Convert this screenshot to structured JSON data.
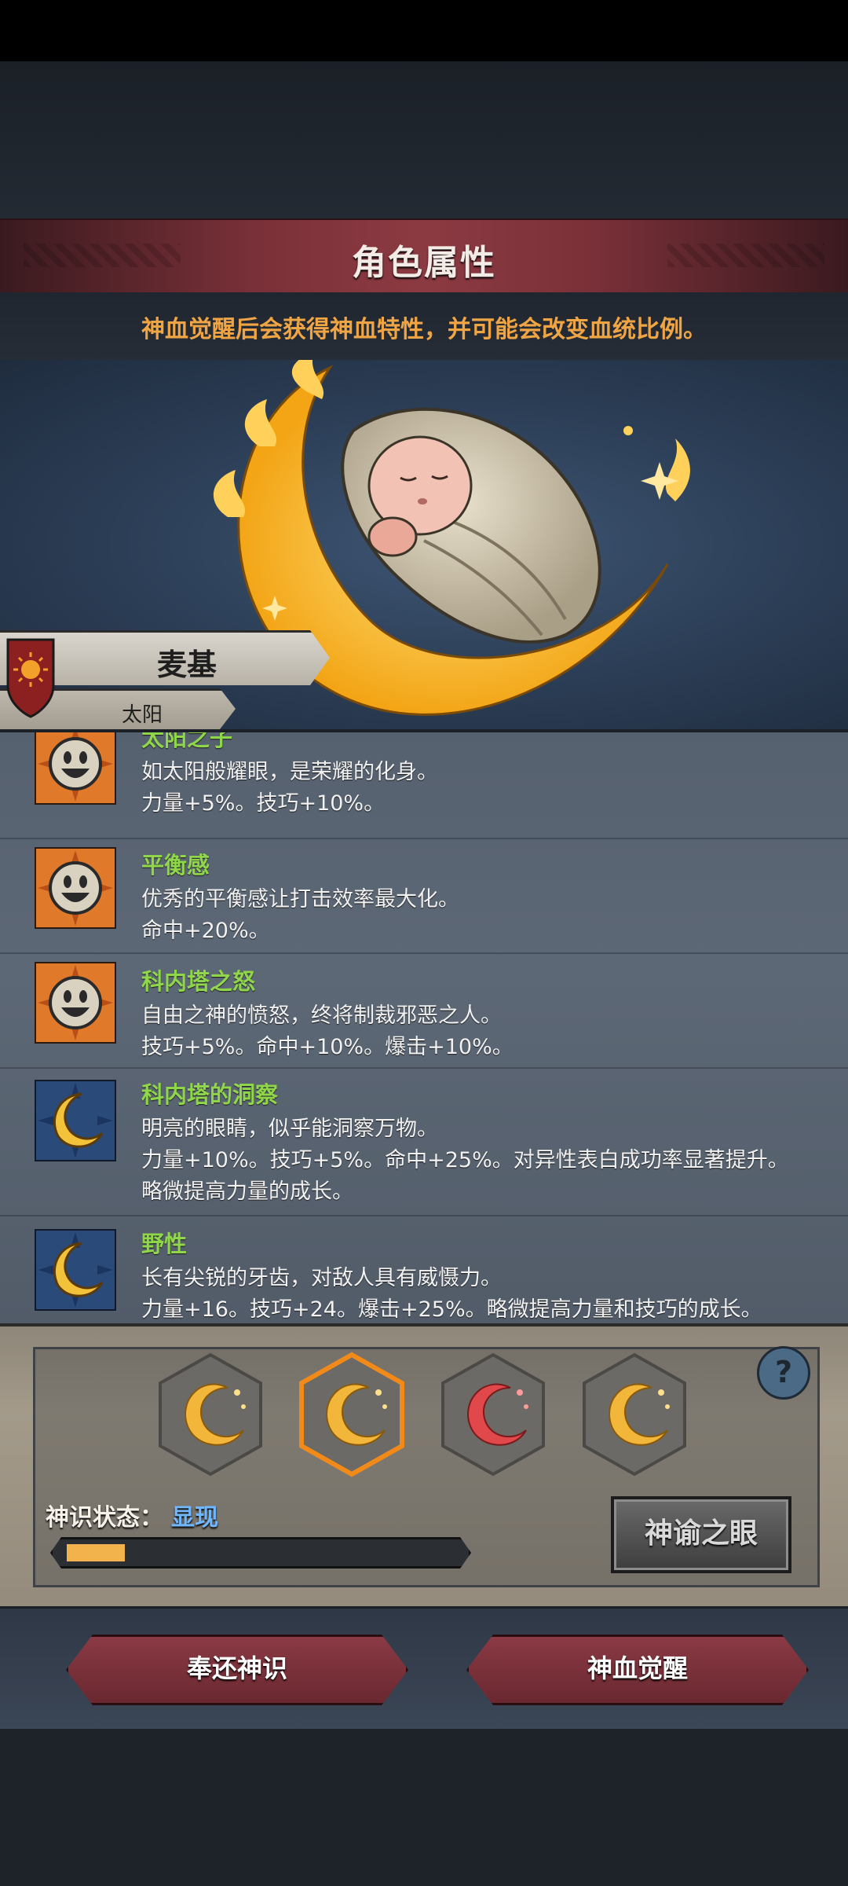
{
  "header": {
    "title": "角色属性",
    "subtitle": "神血觉醒后会获得神血特性，并可能会改变血统比例。"
  },
  "character": {
    "name": "麦基",
    "deity": "太阳"
  },
  "traits": [
    {
      "icon": "sun-face-icon",
      "name": "太阳之子",
      "lines": [
        "如太阳般耀眼，是荣耀的化身。",
        "力量+5%。技巧+10%。"
      ]
    },
    {
      "icon": "sun-face-icon",
      "name": "平衡感",
      "lines": [
        "优秀的平衡感让打击效率最大化。",
        "命中+20%。"
      ]
    },
    {
      "icon": "sun-face-icon",
      "name": "科内塔之怒",
      "lines": [
        "自由之神的愤怒，终将制裁邪恶之人。",
        "技巧+5%。命中+10%。爆击+10%。"
      ]
    },
    {
      "icon": "crescent-moon-icon",
      "name": "科内塔的洞察",
      "lines": [
        "明亮的眼睛，似乎能洞察万物。",
        "力量+10%。技巧+5%。命中+25%。对异性表白成功率显著提升。",
        "略微提高力量的成长。"
      ]
    },
    {
      "icon": "crescent-moon-icon",
      "name": "野性",
      "lines": [
        "长有尖锐的牙齿，对敌人具有威慑力。",
        "力量+16。技巧+24。爆击+25%。略微提高力量和技巧的成长。"
      ]
    }
  ],
  "divine_slots": [
    {
      "name": "divine-slot-1",
      "color": "#f2b63a",
      "selected": false
    },
    {
      "name": "divine-slot-2",
      "color": "#f2b63a",
      "selected": true
    },
    {
      "name": "divine-slot-3",
      "color": "#e0484c",
      "selected": false
    },
    {
      "name": "divine-slot-4",
      "color": "#f2b63a",
      "selected": false
    }
  ],
  "help_label": "?",
  "status": {
    "label": "神识状态：",
    "value": "显现",
    "progress": 0.15
  },
  "buttons": {
    "oracle": "神谕之眼",
    "return": "奉还神识",
    "awaken": "神血觉醒"
  },
  "colors": {
    "trait_name": "#8fd64a",
    "subtitle": "#f0a545",
    "status_value": "#6fb7ff",
    "accent_gold": "#f2b63a"
  }
}
